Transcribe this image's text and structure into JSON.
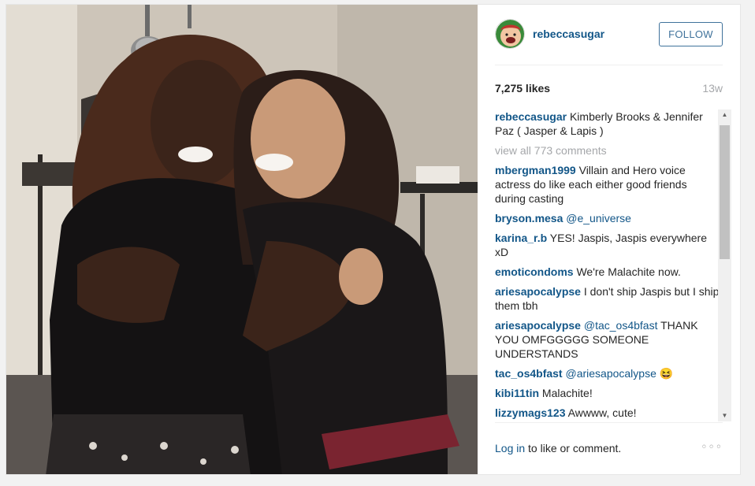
{
  "post": {
    "username": "rebeccasugar",
    "follow_label": "FOLLOW",
    "likes": "7,275 likes",
    "timestamp": "13w",
    "caption": {
      "user": "rebeccasugar",
      "text": "Kimberly Brooks & Jennifer Paz ( Jasper & Lapis )"
    },
    "view_all": "view all 773 comments",
    "comments": [
      {
        "user": "mbergman1999",
        "mention": "",
        "text": "Villain and Hero voice actress do like each either good friends during casting"
      },
      {
        "user": "bryson.mesa",
        "mention": "@e_universe",
        "text": ""
      },
      {
        "user": "karina_r.b",
        "mention": "",
        "text": "YES! Jaspis, Jaspis everywhere xD"
      },
      {
        "user": "emoticondoms",
        "mention": "",
        "text": "We're Malachite now."
      },
      {
        "user": "ariesapocalypse",
        "mention": "",
        "text": "I don't ship Jaspis but I ship them tbh"
      },
      {
        "user": "ariesapocalypse",
        "mention": "@tac_os4bfast",
        "text": "THANK YOU OMFGGGGG SOMEONE UNDERSTANDS"
      },
      {
        "user": "tac_os4bfast",
        "mention": "@ariesapocalypse",
        "text": "😆"
      },
      {
        "user": "kibi11tin",
        "mention": "",
        "text": "Malachite!"
      },
      {
        "user": "lizzymags123",
        "mention": "",
        "text": "Awwww, cute!"
      }
    ],
    "footer": {
      "login": "Log in",
      "rest": " to like or comment.",
      "more": "◦◦◦"
    }
  },
  "colors": {
    "link_blue": "#125688",
    "follow_blue": "#3f729b",
    "muted_gray": "#a5a7aa"
  }
}
